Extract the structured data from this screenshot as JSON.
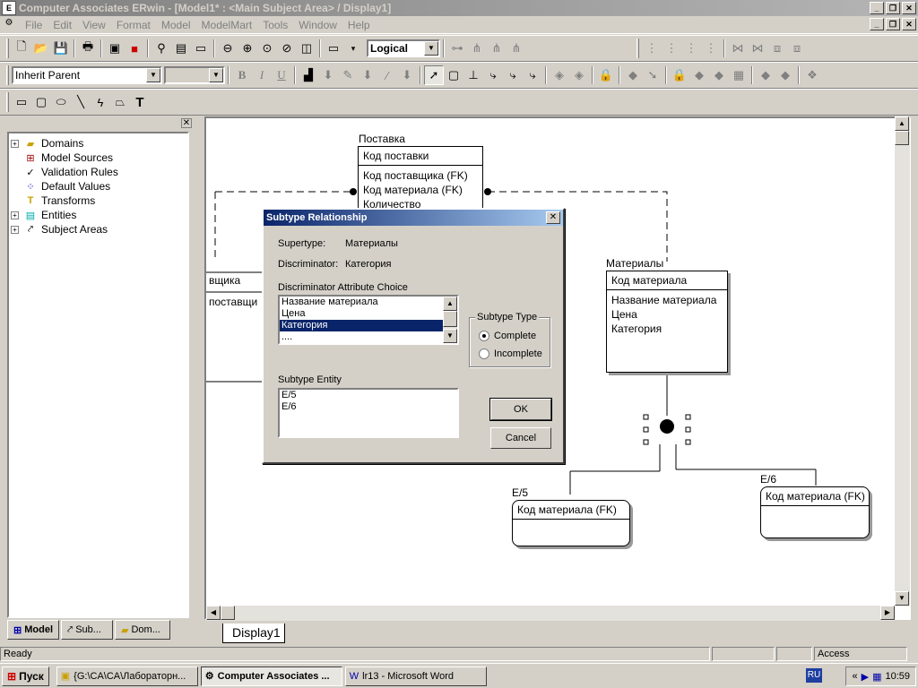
{
  "window": {
    "title": "Computer Associates ERwin - [Model1* : <Main Subject Area> / Display1]"
  },
  "menu": [
    "File",
    "Edit",
    "View",
    "Format",
    "Model",
    "ModelMart",
    "Tools",
    "Window",
    "Help"
  ],
  "toolbar": {
    "view_level": "Logical",
    "inherit_combo": "Inherit Parent",
    "font_bold": "B",
    "font_italic": "I",
    "font_underline": "U",
    "text_tool": "T"
  },
  "tree": {
    "items": [
      {
        "label": "Domains",
        "expandable": true,
        "icon": "domains-icon"
      },
      {
        "label": "Model Sources",
        "expandable": false,
        "icon": "model-sources-icon"
      },
      {
        "label": "Validation Rules",
        "expandable": false,
        "icon": "validation-rules-icon"
      },
      {
        "label": "Default Values",
        "expandable": false,
        "icon": "default-values-icon"
      },
      {
        "label": "Transforms",
        "expandable": false,
        "icon": "transforms-icon"
      },
      {
        "label": "Entities",
        "expandable": true,
        "icon": "entities-icon"
      },
      {
        "label": "Subject Areas",
        "expandable": true,
        "icon": "subject-areas-icon"
      }
    ],
    "tabs": [
      "Model",
      "Sub...",
      "Dom..."
    ]
  },
  "diagram": {
    "postavka": {
      "name": "Поставка",
      "key": "Код поставки",
      "attrs": [
        "Код поставщика (FK)",
        "Код материала (FK)",
        "Количество"
      ]
    },
    "materialy": {
      "name": "Материалы",
      "key": "Код материала",
      "attrs": [
        "Название материала",
        "Цена",
        "Категория"
      ]
    },
    "postavshik": {
      "name_partial": "вщика",
      "key_partial": "поставщи"
    },
    "e5": {
      "name": "E/5",
      "key": "Код материала (FK)"
    },
    "e6": {
      "name": "E/6",
      "key": "Код материала (FK)"
    },
    "tab": "Display1"
  },
  "dialog": {
    "title": "Subtype Relationship",
    "supertype_label": "Supertype:",
    "supertype_value": "Материалы",
    "discriminator_label": "Discriminator:",
    "discriminator_value": "Категория",
    "choice_label": "Discriminator Attribute Choice",
    "choices": [
      "Название материала",
      "Цена",
      "Категория",
      "...."
    ],
    "selected_choice": "Категория",
    "subtype_type_label": "Subtype Type",
    "complete_label": "Complete",
    "incomplete_label": "Incomplete",
    "subtype_type_value": "Complete",
    "subtype_entity_label": "Subtype Entity",
    "subtype_entities": [
      "E/5",
      "E/6"
    ],
    "ok_label": "OK",
    "cancel_label": "Cancel"
  },
  "status": {
    "left": "Ready",
    "right": "Access"
  },
  "taskbar": {
    "start": "Пуск",
    "tasks": [
      {
        "label": "{G:\\CA\\CA\\Лабораторн...",
        "active": false
      },
      {
        "label": "Computer Associates ...",
        "active": true
      },
      {
        "label": "lr13 - Microsoft Word",
        "active": false
      }
    ],
    "lang": "RU",
    "time": "10:59"
  }
}
